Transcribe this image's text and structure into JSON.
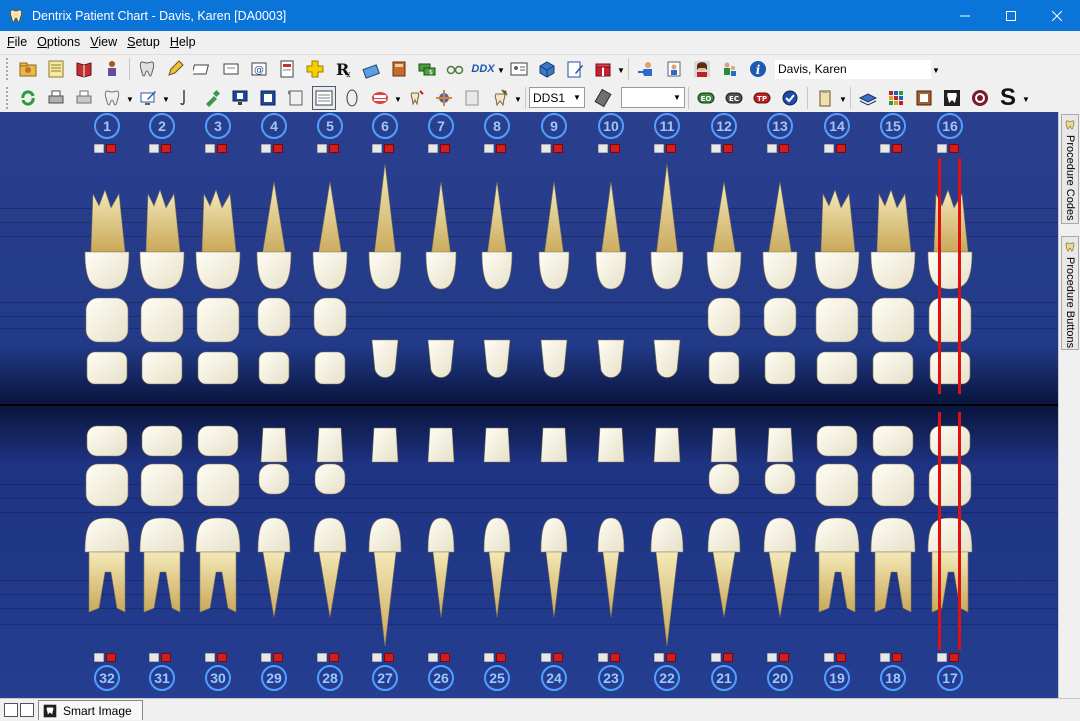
{
  "window": {
    "title": "Dentrix Patient Chart - Davis, Karen [DA0003]"
  },
  "menu": [
    {
      "label": "File"
    },
    {
      "label": "Options"
    },
    {
      "label": "View"
    },
    {
      "label": "Setup"
    },
    {
      "label": "Help"
    }
  ],
  "toolbar": {
    "patient_name": "Davis, Karen",
    "provider": "DDS1",
    "ddx_label": "DDX",
    "s_label": "S",
    "rx_label": "R"
  },
  "chart": {
    "upper_numbers": [
      "1",
      "2",
      "3",
      "4",
      "5",
      "6",
      "7",
      "8",
      "9",
      "10",
      "11",
      "12",
      "13",
      "14",
      "15",
      "16"
    ],
    "lower_numbers": [
      "32",
      "31",
      "30",
      "29",
      "28",
      "27",
      "26",
      "25",
      "24",
      "23",
      "22",
      "21",
      "20",
      "19",
      "18",
      "17"
    ],
    "missing_marked": [
      "16",
      "17"
    ]
  },
  "side_panel": {
    "tabs": [
      {
        "label": "Procedure Codes"
      },
      {
        "label": "Procedure Buttons"
      }
    ]
  },
  "status_bar": {
    "tab_label": "Smart Image"
  }
}
